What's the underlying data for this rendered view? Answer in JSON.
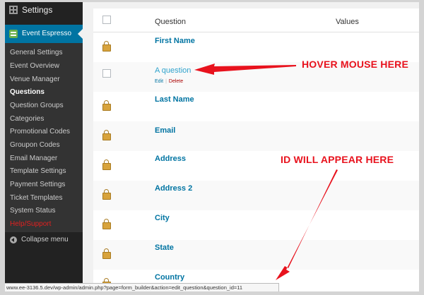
{
  "sidebar": {
    "settings_label": "Settings",
    "plugin_label": "Event Espresso",
    "items": [
      {
        "label": "General Settings"
      },
      {
        "label": "Event Overview"
      },
      {
        "label": "Venue Manager"
      },
      {
        "label": "Questions"
      },
      {
        "label": "Question Groups"
      },
      {
        "label": "Categories"
      },
      {
        "label": "Promotional Codes"
      },
      {
        "label": "Groupon Codes"
      },
      {
        "label": "Email Manager"
      },
      {
        "label": "Template Settings"
      },
      {
        "label": "Payment Settings"
      },
      {
        "label": "Ticket Templates"
      },
      {
        "label": "System Status"
      },
      {
        "label": "Help/Support"
      }
    ],
    "current_item": "Questions",
    "collapse_label": "Collapse menu"
  },
  "table": {
    "columns": [
      "Question",
      "Values"
    ],
    "rows": [
      {
        "title": "First Name",
        "icon": "lock-icon"
      },
      {
        "title": "A question",
        "icon": "checkbox",
        "actions": {
          "edit": "Edit",
          "delete": "Delete"
        }
      },
      {
        "title": "Last Name",
        "icon": "lock-icon"
      },
      {
        "title": "Email",
        "icon": "lock-icon"
      },
      {
        "title": "Address",
        "icon": "lock-icon"
      },
      {
        "title": "Address 2",
        "icon": "lock-icon"
      },
      {
        "title": "City",
        "icon": "lock-icon"
      },
      {
        "title": "State",
        "icon": "lock-icon"
      },
      {
        "title": "Country",
        "icon": "lock-icon"
      }
    ]
  },
  "annotations": {
    "hover": "HOVER MOUSE HERE",
    "id": "ID WILL APPEAR HERE"
  },
  "statusbar": {
    "url": "www.ee-3136.5.dev/wp-admin/admin.php?page=form_builder&action=edit_question&question_id=11"
  },
  "colors": {
    "sidebar_bg": "#222222",
    "accent": "#0074a2",
    "annotation": "#e8121d"
  }
}
